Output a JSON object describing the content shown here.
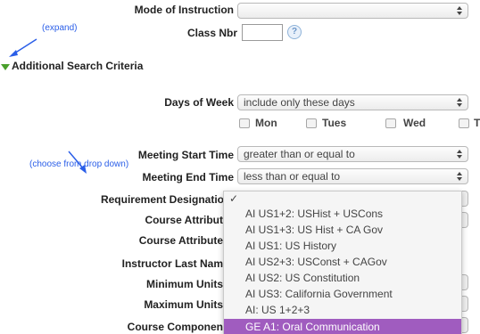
{
  "fields": {
    "mode_label": "Mode of Instruction",
    "mode_value": "",
    "classnbr_label": "Class Nbr",
    "classnbr_value": "",
    "help_glyph": "?",
    "section_title": "Additional Search Criteria",
    "days_label": "Days of Week",
    "days_value": "include only these days",
    "days": [
      "Mon",
      "Tues",
      "Wed",
      "Th"
    ],
    "start_label": "Meeting Start Time",
    "start_value": "greater than or equal to",
    "end_label": "Meeting End Time",
    "end_value": "less than or equal to",
    "req_label": "Requirement Designatio",
    "attr_label": "Course Attribut",
    "attrval_label": "Course Attribute",
    "instructor_label": "Instructor Last Nam",
    "min_units_label": "Minimum Units",
    "max_units_label": "Maximum Units",
    "component_label": "Course Componen"
  },
  "annotations": {
    "expand": "(expand)",
    "choose": "(choose from drop down)"
  },
  "dropdown": {
    "check_glyph": "✓",
    "options": [
      "AI US1+2: USHist + USCons",
      "AI US1+3: US Hist + CA Gov",
      "AI US1: US History",
      "AI US2+3: USConst + CAGov",
      "AI US2: US Constitution",
      "AI US3: California Government",
      "AI: US 1+2+3",
      "GE A1: Oral Communication"
    ],
    "selected_index": 7
  },
  "colors": {
    "annotation": "#2a5ee8",
    "selected_option": "#a05cbf",
    "expand_triangle": "#4aa02c"
  }
}
